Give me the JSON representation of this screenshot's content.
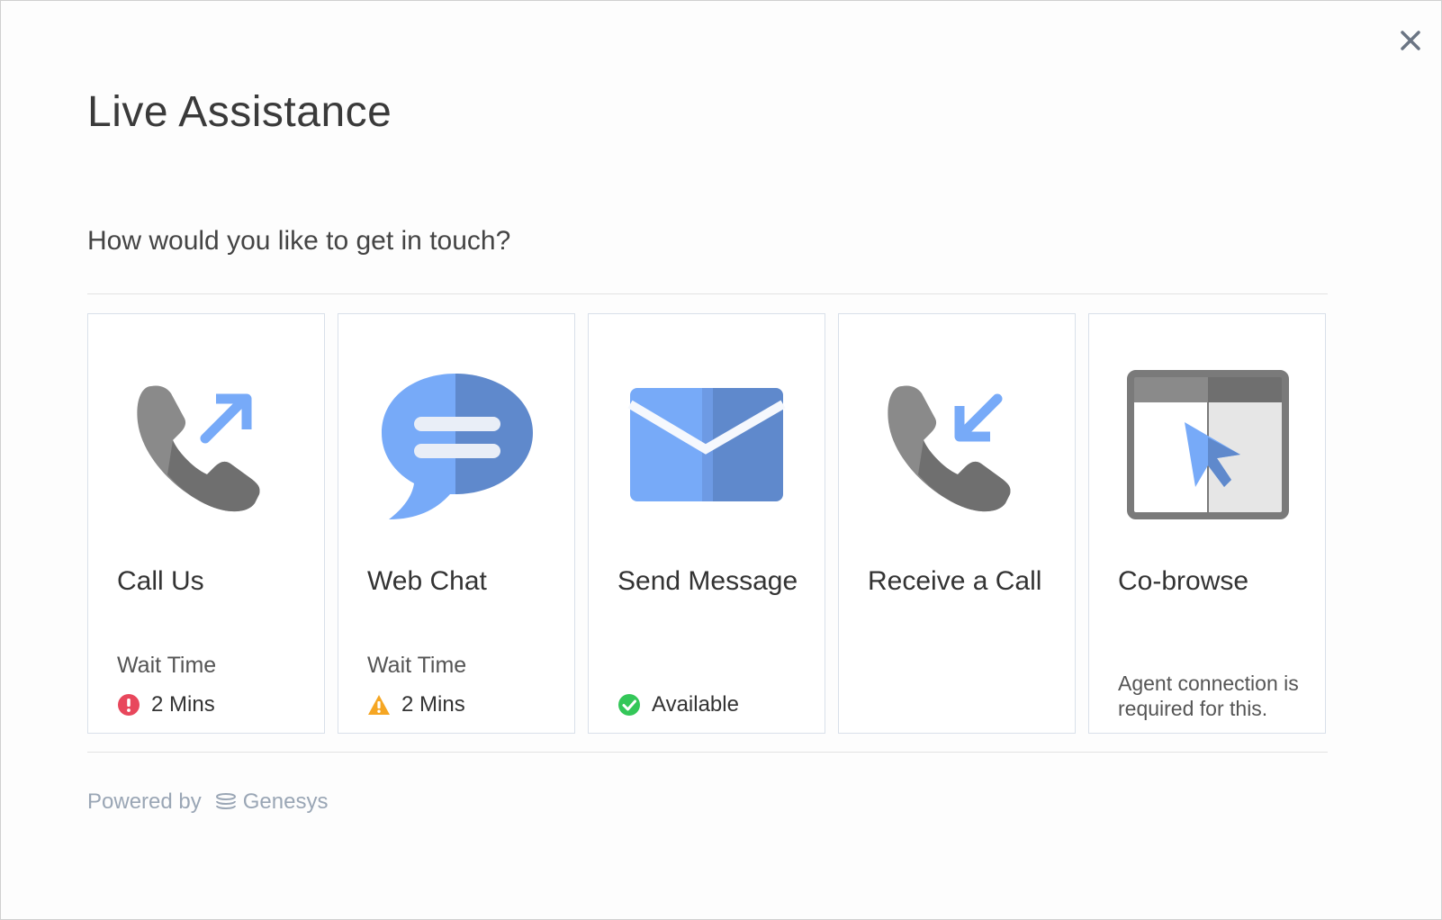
{
  "dialog": {
    "title": "Live Assistance",
    "prompt": "How would you like to get in touch?",
    "close_icon": "close-icon"
  },
  "options": [
    {
      "label": "Call Us",
      "icon": "phone-outgoing-icon",
      "wait_label": "Wait Time",
      "status_text": "2 Mins",
      "status_icon": "error-icon",
      "status_color": "#e8475c"
    },
    {
      "label": "Web Chat",
      "icon": "chat-bubble-icon",
      "wait_label": "Wait Time",
      "status_text": "2 Mins",
      "status_icon": "warning-icon",
      "status_color": "#f5a623"
    },
    {
      "label": "Send Message",
      "icon": "envelope-icon",
      "status_text": "Available",
      "status_icon": "check-icon",
      "status_color": "#34c759"
    },
    {
      "label": "Receive a Call",
      "icon": "phone-incoming-icon"
    },
    {
      "label": "Co-browse",
      "icon": "browser-cursor-icon",
      "note": "Agent connection is required for this."
    }
  ],
  "footer": {
    "powered_by": "Powered by",
    "brand": "Genesys",
    "brand_icon": "genesys-logo-icon"
  },
  "colors": {
    "accent_blue": "#77aaf8",
    "accent_blue_dark": "#5f89cc",
    "icon_gray": "#8a8a8a",
    "icon_gray_dark": "#6f6f6f"
  }
}
